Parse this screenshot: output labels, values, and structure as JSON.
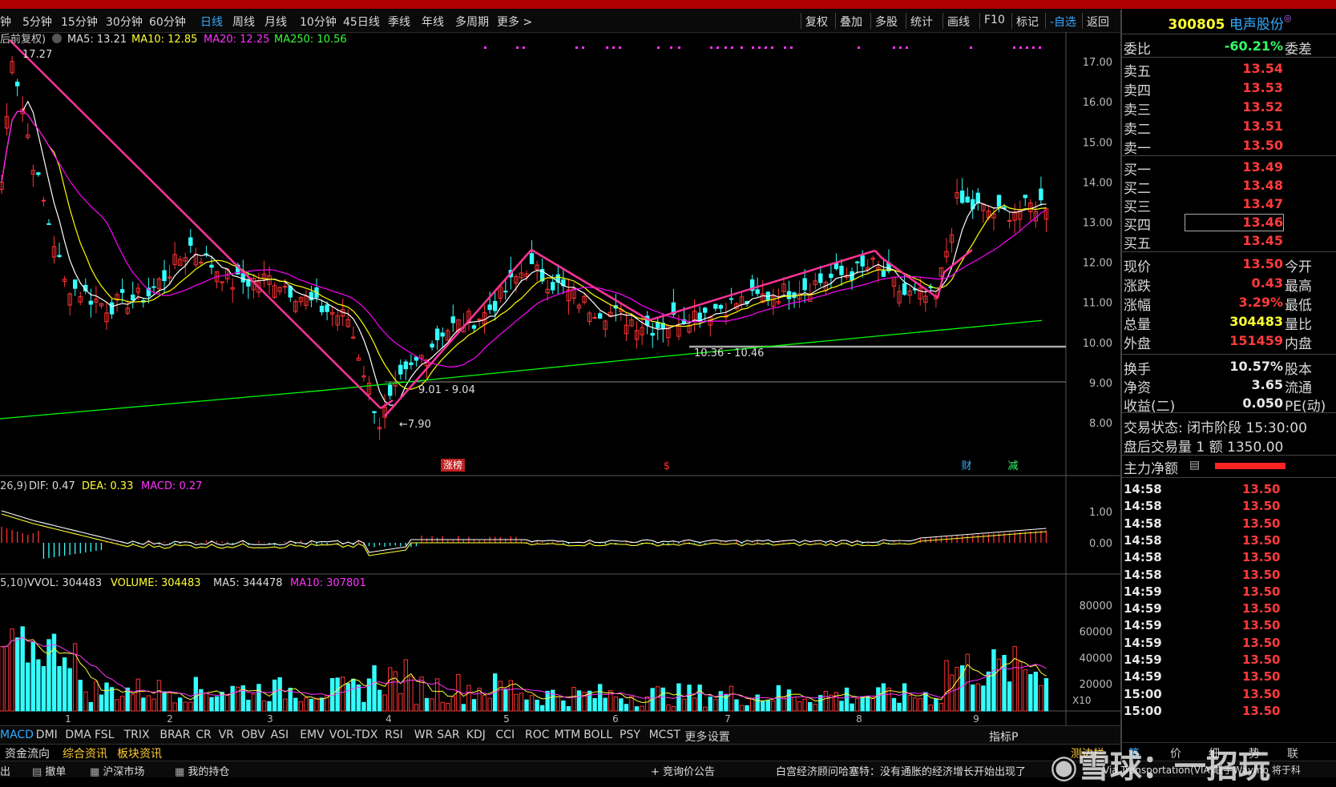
{
  "colors": {
    "up": "#ff3333",
    "down": "#33ffff",
    "ma5": "#ffffff",
    "ma10": "#ffff00",
    "ma20": "#ff00ff",
    "ma250": "#00ff00",
    "trend": "#ff3399",
    "accent": "#33aaff"
  },
  "period_tabs": [
    {
      "label": "钟"
    },
    {
      "label": "5分钟"
    },
    {
      "label": "15分钟"
    },
    {
      "label": "30分钟"
    },
    {
      "label": "60分钟"
    },
    {
      "label": "日线",
      "active": true
    },
    {
      "label": "周线"
    },
    {
      "label": "月线"
    },
    {
      "label": "10分钟"
    },
    {
      "label": "45日线"
    },
    {
      "label": "季线"
    },
    {
      "label": "年线"
    },
    {
      "label": "多周期"
    },
    {
      "label": "更多 >"
    }
  ],
  "tools": [
    "复权",
    "叠加",
    "多股",
    "统计",
    "画线",
    "F10",
    "标记",
    "-自选",
    "返回"
  ],
  "main_legend": {
    "fq": "后前复权)",
    "ma5": "MA5: 13.21",
    "ma10": "MA10: 12.85",
    "ma20": "MA20: 12.25",
    "ma250": "MA250: 10.56",
    "high_label": "17.27"
  },
  "price_axis": [
    "17.00",
    "16.00",
    "15.00",
    "14.00",
    "13.00",
    "12.00",
    "11.00",
    "10.00",
    "9.00",
    "8.00"
  ],
  "annotations": {
    "low": "←7.90",
    "low_range": "9.01 - 9.04",
    "support": "10.36 - 10.46",
    "zhangbang": "涨榜",
    "dollar": "$",
    "cai": "财",
    "jian": "减"
  },
  "macd_legend": {
    "param": "26,9)",
    "dif": "DIF: 0.47",
    "dea": "DEA: 0.33",
    "macd": "MACD: 0.27"
  },
  "macd_axis": [
    "1.00",
    "0.00"
  ],
  "vol_legend": {
    "param": "5,10)",
    "vvol": "VVOL: 304483",
    "volume": "VOLUME: 304483",
    "ma5": "MA5: 344478",
    "ma10": "MA10: 307801"
  },
  "vol_axis": [
    "80000",
    "60000",
    "40000",
    "20000",
    "X10"
  ],
  "months": [
    "1",
    "2",
    "3",
    "4",
    "5",
    "6",
    "7",
    "8",
    "9"
  ],
  "indicators": [
    "MACD",
    "DMI",
    "DMA",
    "FSL",
    "TRIX",
    "BRAR",
    "CR",
    "VR",
    "OBV",
    "ASI",
    "EMV",
    "VOL-TDX",
    "RSI",
    "WR",
    "SAR",
    "KDJ",
    "CCI",
    "ROC",
    "MTM",
    "BOLL",
    "PSY",
    "MCST",
    "更多",
    "设置"
  ],
  "indicator_right": "指标P",
  "info_tabs": [
    "资金流向",
    "综合资讯",
    "板块资讯"
  ],
  "status": {
    "left1": "出",
    "left2": "撤单",
    "left3": "沪深市场",
    "left4": "我的持仓",
    "notice": "+ 竞询价公告",
    "news1": "白宫经济顾问哈塞特：没有通胀的经济增长开始出现了",
    "news2": "Via Transportation(VIA)联手Waymo 将于科"
  },
  "stock": {
    "code": "300805",
    "name": "电声股份"
  },
  "weibi": {
    "label": "委比",
    "value": "-60.21%",
    "right": "委差"
  },
  "sells": [
    {
      "label": "卖五",
      "price": "13.54"
    },
    {
      "label": "卖四",
      "price": "13.53"
    },
    {
      "label": "卖三",
      "price": "13.52"
    },
    {
      "label": "卖二",
      "price": "13.51"
    },
    {
      "label": "卖一",
      "price": "13.50"
    }
  ],
  "buys": [
    {
      "label": "买一",
      "price": "13.49"
    },
    {
      "label": "买二",
      "price": "13.48"
    },
    {
      "label": "买三",
      "price": "13.47"
    },
    {
      "label": "买四",
      "price": "13.46"
    },
    {
      "label": "买五",
      "price": "13.45"
    }
  ],
  "quote": [
    {
      "label": "现价",
      "value": "13.50",
      "right": "今开",
      "color": "#ff3b3b"
    },
    {
      "label": "涨跌",
      "value": "0.43",
      "right": "最高",
      "color": "#ff3b3b"
    },
    {
      "label": "涨幅",
      "value": "3.29%",
      "right": "最低",
      "color": "#ff3b3b"
    },
    {
      "label": "总量",
      "value": "304483",
      "right": "量比",
      "color": "#ffff33"
    },
    {
      "label": "外盘",
      "value": "151459",
      "right": "内盘",
      "color": "#ff3b3b"
    }
  ],
  "fund": [
    {
      "label": "换手",
      "value": "10.57%",
      "right": "股本"
    },
    {
      "label": "净资",
      "value": "3.65",
      "right": "流通"
    },
    {
      "label": "收益(二)",
      "value": "0.050",
      "right": "PE(动)"
    }
  ],
  "trade_state": "交易状态: 闭市阶段 15:30:00",
  "after_hours": "盘后交易量 1 额 1350.00",
  "main_net": "主力净额",
  "ticks": [
    {
      "t": "14:58",
      "p": "13.50"
    },
    {
      "t": "14:58",
      "p": "13.50"
    },
    {
      "t": "14:58",
      "p": "13.50"
    },
    {
      "t": "14:58",
      "p": "13.50"
    },
    {
      "t": "14:58",
      "p": "13.50"
    },
    {
      "t": "14:58",
      "p": "13.50"
    },
    {
      "t": "14:59",
      "p": "13.50"
    },
    {
      "t": "14:59",
      "p": "13.50"
    },
    {
      "t": "14:59",
      "p": "13.50"
    },
    {
      "t": "14:59",
      "p": "13.50"
    },
    {
      "t": "14:59",
      "p": "13.50"
    },
    {
      "t": "14:59",
      "p": "13.50"
    },
    {
      "t": "15:00",
      "p": "13.50"
    },
    {
      "t": "15:00",
      "p": "13.50"
    }
  ],
  "right_tabs": [
    "测边栏",
    "笔",
    "价",
    "细",
    "势",
    "联"
  ],
  "watermark": "雪球：一招玩"
}
